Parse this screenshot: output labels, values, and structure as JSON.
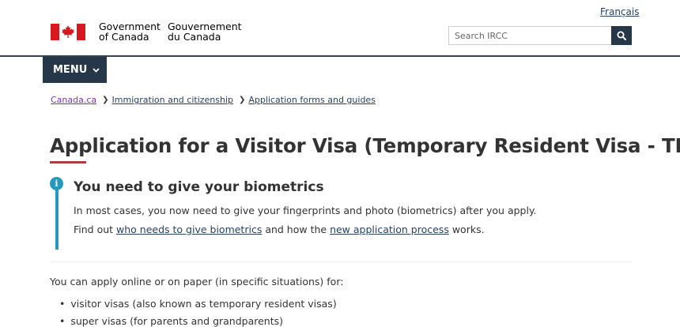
{
  "header": {
    "language_link": "Français",
    "signature_en_line1": "Government",
    "signature_en_line2": "of Canada",
    "signature_fr_line1": "Gouvernement",
    "signature_fr_line2": "du Canada",
    "search_placeholder": "Search IRCC",
    "search_icon": "magnifier-icon",
    "colors": {
      "navy": "#26374a",
      "flag_red": "#d7191f"
    }
  },
  "menu": {
    "label": "MENU",
    "icon": "chevron-down-icon"
  },
  "breadcrumb": {
    "items": [
      "Canada.ca",
      "Immigration and citizenship",
      "Application forms and guides"
    ]
  },
  "page": {
    "title": "Application for a Visitor Visa (Temporary Resident Visa - TRV)",
    "title_accent_color": "#af3c43"
  },
  "alert": {
    "icon": "info-icon",
    "icon_glyph": "i",
    "color": "#269abc",
    "heading": "You need to give your biometrics",
    "line1": "In most cases, you now need to give your fingerprints and photo (biometrics) after you apply.",
    "line2_before": "Find out ",
    "line2_link1": "who needs to give biometrics",
    "line2_middle": " and how the ",
    "line2_link2": "new application process",
    "line2_after": " works."
  },
  "content": {
    "intro": "You can apply online or on paper (in specific situations) for:",
    "items": [
      "visitor visas (also known as temporary resident visas)",
      "super visas (for parents and grandparents)"
    ]
  }
}
